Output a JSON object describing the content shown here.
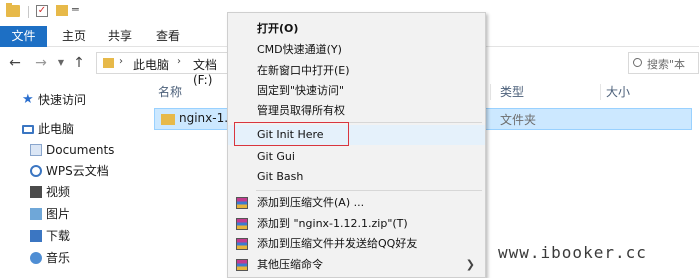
{
  "ribbon": {
    "tabs": [
      "文件",
      "主页",
      "共享",
      "查看"
    ]
  },
  "address": {
    "segments": [
      "此电脑",
      "文档 (F:)"
    ],
    "search_placeholder": "搜索\"本"
  },
  "nav_pane": {
    "items": [
      "快速访问",
      "此电脑",
      "Documents",
      "WPS云文档",
      "视频",
      "图片",
      "下载",
      "音乐"
    ]
  },
  "file_list": {
    "columns": [
      "名称",
      "类型",
      "大小"
    ],
    "rows": [
      {
        "name": "nginx-1.1",
        "type": "文件夹"
      }
    ]
  },
  "context_menu": {
    "items": [
      "打开(O)",
      "CMD快速通道(Y)",
      "在新窗口中打开(E)",
      "固定到\"快速访问\"",
      "管理员取得所有权",
      "Git Init Here",
      "Git Gui",
      "Git Bash",
      "添加到压缩文件(A) ...",
      "添加到 \"nginx-1.12.1.zip\"(T)",
      "添加到压缩文件并发送给QQ好友",
      "其他压缩命令"
    ],
    "highlighted_item": "Git Init Here"
  },
  "watermark": "www.ibooker.cc",
  "colors": {
    "accent": "#1d6fc4",
    "selection": "#cce8ff",
    "highlight_border": "#d9363e",
    "menu_background": "#f2f2f2"
  }
}
